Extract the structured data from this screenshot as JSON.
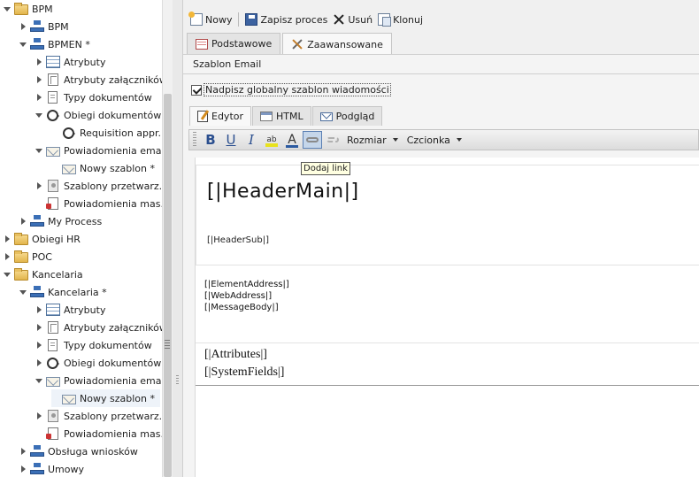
{
  "tree": [
    {
      "label": "BPM",
      "icon": "folder-icon",
      "state": "expanded",
      "indent": 0
    },
    {
      "label": "BPM",
      "icon": "process-icon",
      "state": "collapsed",
      "indent": 1
    },
    {
      "label": "BPMEN *",
      "icon": "process-icon",
      "state": "expanded",
      "indent": 1
    },
    {
      "label": "Atrybuty",
      "icon": "table-icon",
      "state": "collapsed",
      "indent": 2
    },
    {
      "label": "Atrybuty załączników",
      "icon": "attachment-icon",
      "state": "collapsed",
      "indent": 2
    },
    {
      "label": "Typy dokumentów",
      "icon": "document-icon",
      "state": "collapsed",
      "indent": 2
    },
    {
      "label": "Obiegi dokumentów",
      "icon": "cycle-icon",
      "state": "expanded",
      "indent": 2
    },
    {
      "label": "Requisition appr...",
      "icon": "cycle-icon",
      "state": "none",
      "indent": 3
    },
    {
      "label": "Powiadomienia email",
      "icon": "mail-icon",
      "state": "expanded",
      "indent": 2
    },
    {
      "label": "Nowy szablon *",
      "icon": "mail-icon",
      "state": "none",
      "indent": 3
    },
    {
      "label": "Szablony przetwarz...",
      "icon": "gear-icon",
      "state": "collapsed",
      "indent": 2
    },
    {
      "label": "Powiadomienia mas...",
      "icon": "notify-icon",
      "state": "none",
      "indent": 2
    },
    {
      "label": "My Process",
      "icon": "process-icon",
      "state": "collapsed",
      "indent": 1
    },
    {
      "label": "Obiegi HR",
      "icon": "folder-icon",
      "state": "collapsed",
      "indent": 0
    },
    {
      "label": "POC",
      "icon": "folder-icon",
      "state": "collapsed",
      "indent": 0
    },
    {
      "label": "Kancelaria",
      "icon": "folder-icon",
      "state": "expanded",
      "indent": 0
    },
    {
      "label": "Kancelaria *",
      "icon": "process-icon",
      "state": "expanded",
      "indent": 1
    },
    {
      "label": "Atrybuty",
      "icon": "table-icon",
      "state": "collapsed",
      "indent": 2
    },
    {
      "label": "Atrybuty załączników",
      "icon": "attachment-icon",
      "state": "collapsed",
      "indent": 2
    },
    {
      "label": "Typy dokumentów",
      "icon": "document-icon",
      "state": "collapsed",
      "indent": 2
    },
    {
      "label": "Obiegi dokumentów",
      "icon": "cycle-icon",
      "state": "collapsed",
      "indent": 2
    },
    {
      "label": "Powiadomienia email",
      "icon": "mail-icon",
      "state": "expanded",
      "indent": 2
    },
    {
      "label": "Nowy szablon *",
      "icon": "mail-icon",
      "state": "none",
      "indent": 3,
      "selected": true
    },
    {
      "label": "Szablony przetwarz...",
      "icon": "gear-icon",
      "state": "collapsed",
      "indent": 2
    },
    {
      "label": "Powiadomienia mas...",
      "icon": "notify-icon",
      "state": "none",
      "indent": 2
    },
    {
      "label": "Obsługa wniosków",
      "icon": "process-icon",
      "state": "collapsed",
      "indent": 1
    },
    {
      "label": "Umowy",
      "icon": "process-icon",
      "state": "collapsed",
      "indent": 1
    }
  ],
  "toolbar": {
    "new_label": "Nowy",
    "save_label": "Zapisz proces",
    "delete_label": "Usuń",
    "clone_label": "Klonuj"
  },
  "tabs": {
    "basic": "Podstawowe",
    "advanced": "Zaawansowane"
  },
  "section": {
    "title": "Szablon Email",
    "override_label": "Nadpisz globalny szablon wiadomości",
    "override_checked": true
  },
  "editor_tabs": {
    "editor": "Edytor",
    "html": "HTML",
    "preview": "Podgląd"
  },
  "format_bar": {
    "bold": "B",
    "underline": "U",
    "italic": "I",
    "highlight": "ab",
    "font_color": "A",
    "size_label": "Rozmiar",
    "font_label": "Czcionka"
  },
  "tooltip": "Dodaj link",
  "template": {
    "header_main": "[|HeaderMain|]",
    "header_sub": "[|HeaderSub|]",
    "element_address": "[|ElementAddress|]",
    "web_address": "[|WebAddress|]",
    "message_body": "[|MessageBody|]",
    "attributes": "[|Attributes|]",
    "system_fields": "[|SystemFields|]"
  }
}
